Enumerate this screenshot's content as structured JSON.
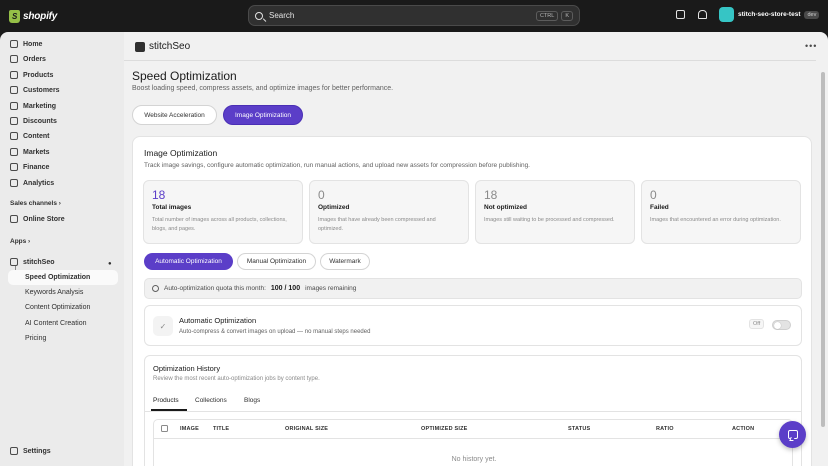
{
  "topbar": {
    "logo_text": "shopify",
    "search_placeholder": "Search",
    "shortcut_keys": [
      "CTRL",
      "K"
    ],
    "store_name": "stitch-seo-store-test",
    "store_badge": "dev"
  },
  "sidebar": {
    "nav": [
      {
        "label": "Home",
        "icon": "home-icon"
      },
      {
        "label": "Orders",
        "icon": "orders-icon"
      },
      {
        "label": "Products",
        "icon": "products-icon"
      },
      {
        "label": "Customers",
        "icon": "customers-icon"
      },
      {
        "label": "Marketing",
        "icon": "marketing-icon"
      },
      {
        "label": "Discounts",
        "icon": "discounts-icon"
      },
      {
        "label": "Content",
        "icon": "content-icon"
      },
      {
        "label": "Markets",
        "icon": "markets-icon"
      },
      {
        "label": "Finance",
        "icon": "finance-icon"
      },
      {
        "label": "Analytics",
        "icon": "analytics-icon"
      }
    ],
    "sales_channels_label": "Sales channels",
    "online_store_label": "Online Store",
    "apps_label": "Apps",
    "app_name": "stitchSeo",
    "app_pages": [
      "Speed Optimization",
      "Keywords Analysis",
      "Content Optimization",
      "AI Content Creation",
      "Pricing"
    ],
    "settings_label": "Settings"
  },
  "app": {
    "title": "stitchSeo"
  },
  "page": {
    "title": "Speed Optimization",
    "subtitle": "Boost loading speed, compress assets, and optimize images for better performance.",
    "tabs": [
      "Website Acceleration",
      "Image Optimization"
    ],
    "active_tab": "Image Optimization"
  },
  "card": {
    "title": "Image Optimization",
    "subtitle": "Track image savings, configure automatic optimization, run manual actions, and upload new assets for compression before publishing.",
    "stats": [
      {
        "value": "18",
        "label": "Total images",
        "desc": "Total number of images across all products, collections, blogs, and pages."
      },
      {
        "value": "0",
        "label": "Optimized",
        "desc": "Images that have already been compressed and optimized."
      },
      {
        "value": "18",
        "label": "Not optimized",
        "desc": "Images still waiting to be processed and compressed."
      },
      {
        "value": "0",
        "label": "Failed",
        "desc": "Images that encountered an error during optimization."
      }
    ],
    "segments": [
      "Automatic Optimization",
      "Manual Optimization",
      "Watermark"
    ],
    "active_segment": "Automatic Optimization",
    "quota": {
      "label": "Auto-optimization quota this month:",
      "value": "100 / 100",
      "suffix": "images remaining"
    },
    "auto": {
      "title": "Automatic Optimization",
      "desc": "Auto-compress & convert images on upload — no manual steps needed",
      "status": "Off"
    },
    "history": {
      "title": "Optimization History",
      "subtitle": "Review the most recent auto-optimization jobs by content type.",
      "tabs": [
        "Products",
        "Collections",
        "Blogs"
      ],
      "active_tab": "Products",
      "columns": [
        "IMAGE",
        "TITLE",
        "ORIGINAL SIZE",
        "OPTIMIZED SIZE",
        "STATUS",
        "RATIO",
        "ACTION"
      ],
      "empty": "No history yet."
    }
  },
  "colors": {
    "accent": "#5b3ec8",
    "topbar": "#1a1a1a",
    "sidebar": "#ebebeb"
  }
}
